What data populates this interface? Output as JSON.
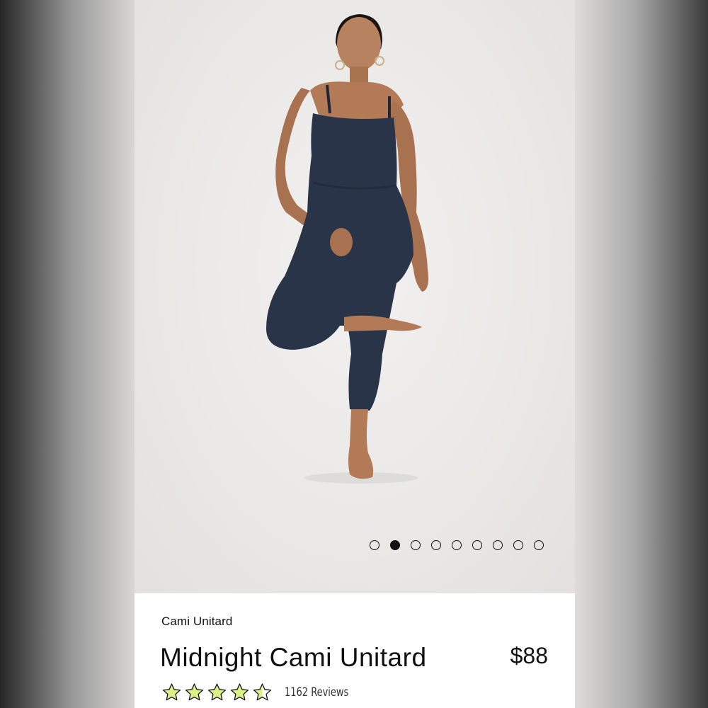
{
  "product": {
    "collection": "Cami Unitard",
    "name": "Midnight Cami Unitard",
    "price": "$88",
    "rating": 4.5,
    "reviews_label": "1162 Reviews",
    "image_alt": "Model wearing a midnight navy cami unitard, balancing on one leg"
  },
  "carousel": {
    "total_slides": 9,
    "active_index": 1
  },
  "colors": {
    "star_fill": "#d9f283",
    "garment": "#2a3449",
    "background": "#e9e8e7"
  }
}
